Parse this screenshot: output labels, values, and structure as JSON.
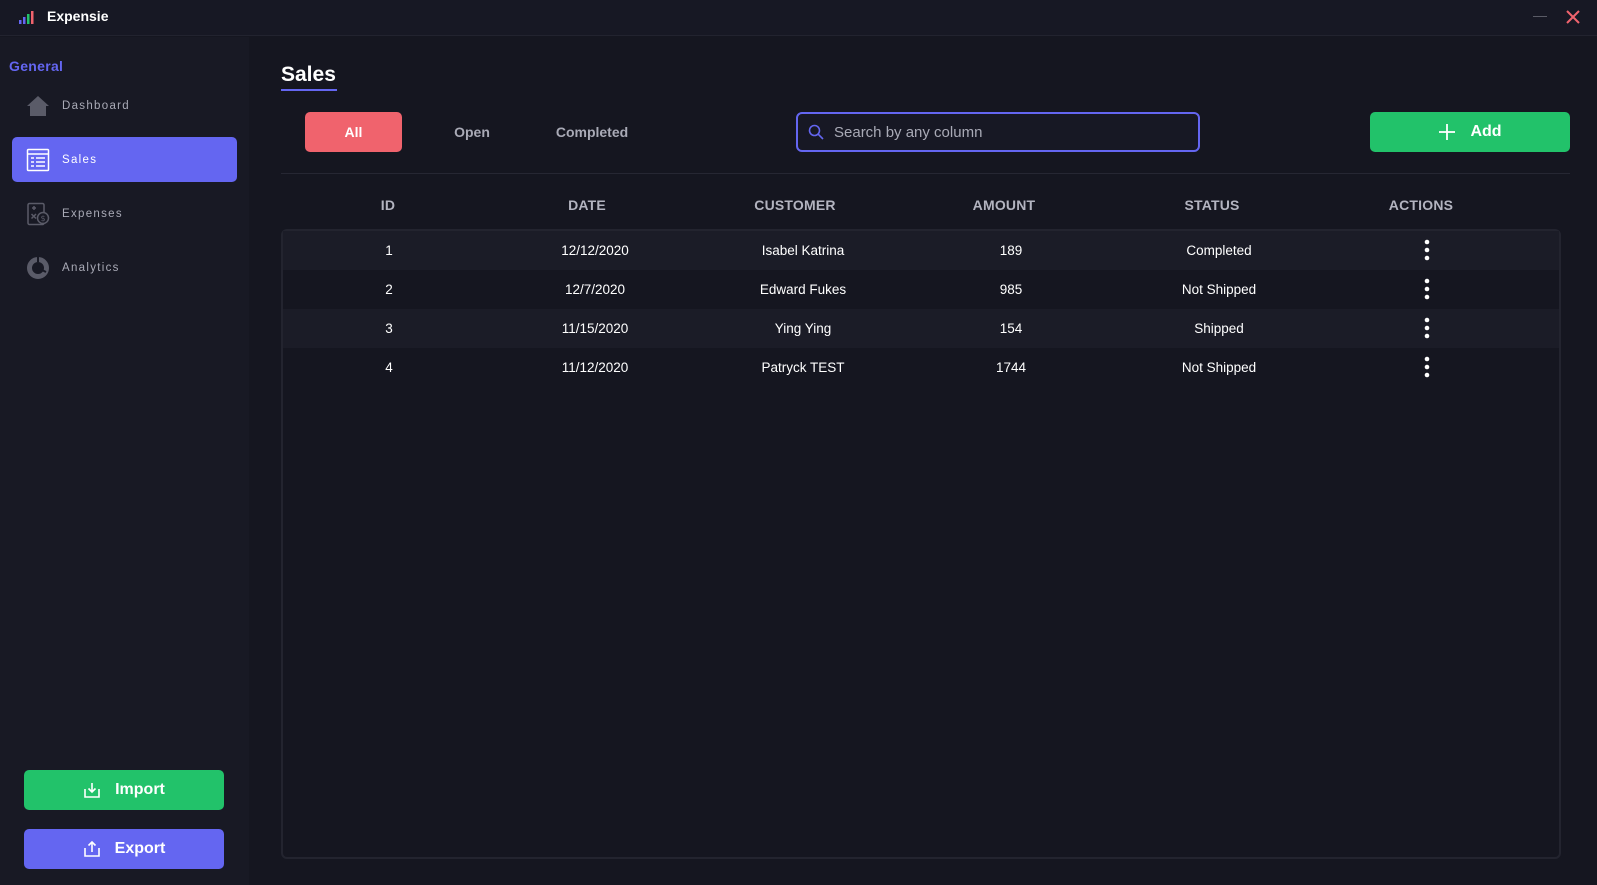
{
  "app": {
    "title": "Expensie"
  },
  "sidebar": {
    "section_label": "General",
    "items": [
      {
        "label": "Dashboard",
        "icon": "home-icon",
        "active": false
      },
      {
        "label": "Sales",
        "icon": "sales-list-icon",
        "active": true
      },
      {
        "label": "Expenses",
        "icon": "expenses-calculator-icon",
        "active": false
      },
      {
        "label": "Analytics",
        "icon": "donut-chart-icon",
        "active": false
      }
    ],
    "import_label": "Import",
    "export_label": "Export"
  },
  "main": {
    "title": "Sales",
    "filters": [
      {
        "label": "All",
        "active": true
      },
      {
        "label": "Open",
        "active": false
      },
      {
        "label": "Completed",
        "active": false
      }
    ],
    "search": {
      "placeholder": "Search by any column",
      "value": ""
    },
    "add_label": "Add",
    "table": {
      "headers": [
        "ID",
        "DATE",
        "CUSTOMER",
        "AMOUNT",
        "STATUS",
        "ACTIONS"
      ],
      "rows": [
        {
          "id": "1",
          "date": "12/12/2020",
          "customer": "Isabel Katrina",
          "amount": "189",
          "status": "Completed"
        },
        {
          "id": "2",
          "date": "12/7/2020",
          "customer": "Edward Fukes",
          "amount": "985",
          "status": "Not Shipped"
        },
        {
          "id": "3",
          "date": "11/15/2020",
          "customer": "Ying Ying",
          "amount": "154",
          "status": "Shipped"
        },
        {
          "id": "4",
          "date": "11/12/2020",
          "customer": "Patryck TEST",
          "amount": "1744",
          "status": "Not Shipped"
        }
      ]
    }
  },
  "colors": {
    "accent": "#6466f1",
    "green": "#22c26a",
    "active_filter": "#f0636d",
    "close": "#f0636d",
    "background": "#151620"
  }
}
